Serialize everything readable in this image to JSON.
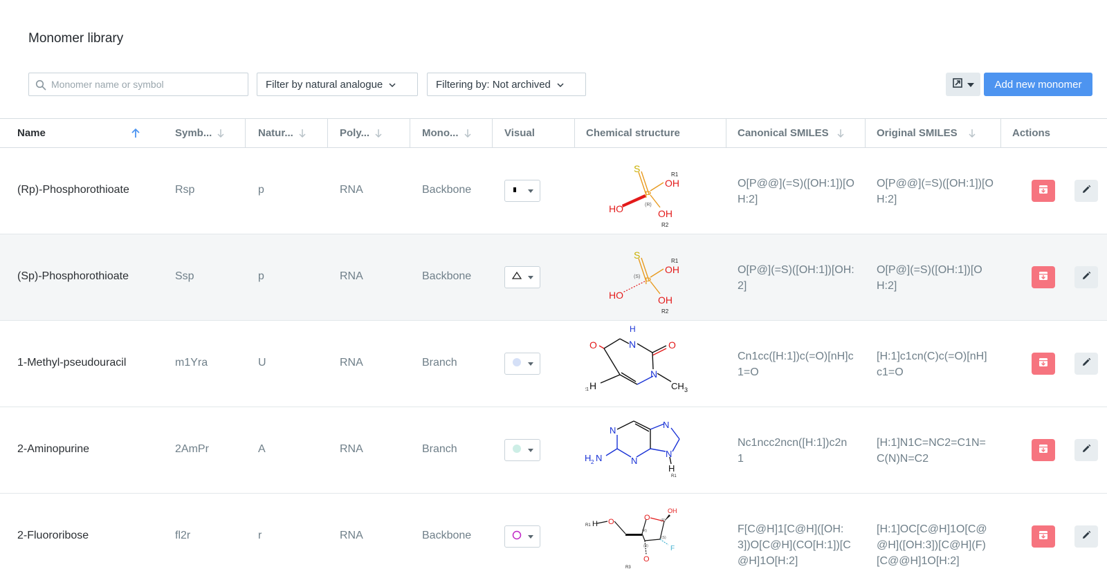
{
  "page": {
    "title": "Monomer library"
  },
  "toolbar": {
    "search_placeholder": "Monomer name or symbol",
    "search_value": "",
    "natural_filter_label": "Filter by natural analogue",
    "archived_filter_label": "Filtering by: Not archived",
    "add_button_label": "Add new monomer",
    "export_icon": "export-icon",
    "primary_color": "#4d94f0"
  },
  "table": {
    "columns": [
      {
        "label": "Name",
        "sort": "asc"
      },
      {
        "label": "Symb...",
        "sort": "none"
      },
      {
        "label": "Natur...",
        "sort": "none"
      },
      {
        "label": "Poly...",
        "sort": "none"
      },
      {
        "label": "Mono...",
        "sort": "none"
      },
      {
        "label": "Visual",
        "sort": ""
      },
      {
        "label": "Chemical structure",
        "sort": ""
      },
      {
        "label": "Canonical SMILES",
        "sort": "none"
      },
      {
        "label": "Original SMILES",
        "sort": "none"
      },
      {
        "label": "Actions",
        "sort": ""
      }
    ],
    "rows": [
      {
        "name": "(Rp)-Phosphorothioate",
        "symbol": "Rsp",
        "natural": "p",
        "polymer": "RNA",
        "monomer": "Backbone",
        "visual": "small-square",
        "visual_color": "#000000",
        "structure": {
          "S": "S",
          "P": "P",
          "OH1": "OH",
          "HO": "HO",
          "OH2": "OH",
          "R1": "R1",
          "R2": "R2",
          "stereo": "(R)"
        },
        "canonical_smiles": [
          "O[P@@](=S)([OH:1])[O",
          "H:2]"
        ],
        "original_smiles": [
          "O[P@@](=S)([OH:1])[O",
          "H:2]"
        ]
      },
      {
        "name": "(Sp)-Phosphorothioate",
        "symbol": "Ssp",
        "natural": "p",
        "polymer": "RNA",
        "monomer": "Backbone",
        "visual": "triangle",
        "visual_color": "#000000",
        "structure": {
          "S": "S",
          "P": "P",
          "OH1": "OH",
          "HO": "HO",
          "OH2": "OH",
          "R1": "R1",
          "R2": "R2",
          "stereo": "(S)"
        },
        "canonical_smiles": [
          "O[P@](=S)([OH:1])[OH:",
          "2]"
        ],
        "original_smiles": [
          "O[P@](=S)([OH:1])[O",
          "H:2]"
        ]
      },
      {
        "name": "1-Methyl-pseudouracil",
        "symbol": "m1Yra",
        "natural": "U",
        "polymer": "RNA",
        "monomer": "Branch",
        "visual": "circle-filled",
        "visual_color": "#d5e0f7",
        "structure": {
          "O1": "O",
          "H_N": "H",
          "N1": "N",
          "O2": "O",
          "H": "H",
          "N2": "N",
          "CH": "CH",
          "sub3": "3",
          "R1": "R1"
        },
        "canonical_smiles": [
          "Cn1cc([H:1])c(=O)[nH]c",
          "1=O"
        ],
        "original_smiles": [
          "[H:1]c1cn(C)c(=O)[nH]",
          "c1=O"
        ]
      },
      {
        "name": "2-Aminopurine",
        "symbol": "2AmPr",
        "natural": "A",
        "polymer": "RNA",
        "monomer": "Branch",
        "visual": "circle-filled",
        "visual_color": "#cdeee6",
        "structure": {
          "N1": "N",
          "N2": "N",
          "N3": "N",
          "N4": "N",
          "H2": "H",
          "N_amine": "N",
          "sub2": "2",
          "H": "H",
          "R1": "R1"
        },
        "canonical_smiles": [
          "Nc1ncc2ncn([H:1])c2n",
          "1"
        ],
        "original_smiles": [
          "[H:1]N1C=NC2=C1N=",
          "C(N)N=C2"
        ]
      },
      {
        "name": "2-Fluororibose",
        "symbol": "fl2r",
        "natural": "r",
        "polymer": "RNA",
        "monomer": "Backbone",
        "visual": "circle-outline",
        "visual_color": "#c026c6",
        "structure": {
          "R1": "R1",
          "H": "H",
          "O1": "O",
          "O_ring": "O",
          "OH": "OH",
          "F": "F",
          "O2": "O",
          "R3": "R3",
          "stereo_a": "(R)",
          "stereo_b": "(R)",
          "stereo_c": "(S)",
          "stereo_d": "(R)"
        },
        "canonical_smiles": [
          "F[C@H]1[C@H]([OH:",
          "3])O[C@H](CO[H:1])[C",
          "@H]1O[H:2]"
        ],
        "original_smiles": [
          "[H:1]OC[C@H]1O[C@",
          "@H]([OH:3])[C@H](F)",
          "[C@@H]1O[H:2]"
        ]
      }
    ]
  },
  "colors": {
    "delete_button": "#f6747f",
    "edit_button": "#e8edf0",
    "alt_row": "#f4f6f7"
  }
}
